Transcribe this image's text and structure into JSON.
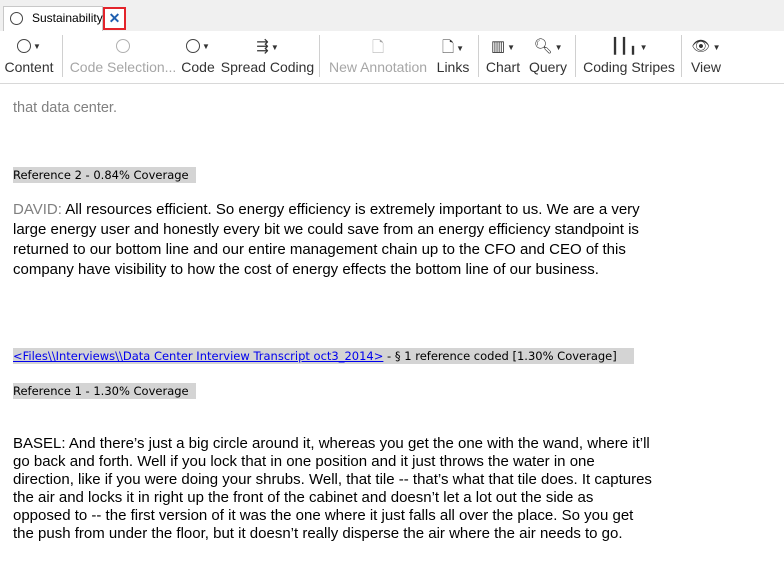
{
  "tab": {
    "label": "Sustainability",
    "close_glyph": "✕"
  },
  "ribbon": {
    "content": "Content",
    "code_selection": "Code Selection...",
    "code": "Code",
    "spread_coding": "Spread Coding",
    "new_annotation": "New Annotation",
    "links": "Links",
    "chart": "Chart",
    "query": "Query",
    "coding_stripes": "Coding Stripes",
    "view": "View"
  },
  "doc": {
    "top_fragment": "that data center.",
    "ref2_header": "Reference 2 - 0.84% Coverage",
    "david_speaker": "DAVID:",
    "david_text": "All resources efficient. So energy efficiency is extremely important to us. We are a very large energy user and honestly every bit we could save from an energy efficiency standpoint is returned to our bottom line and our entire management chain up to the CFO and CEO of this company have visibility to how the cost of energy effects the bottom line of our business.",
    "file_link": "<Files\\\\Interviews\\\\Data Center Interview Transcript oct3_2014>",
    "file_meta": " - § 1 reference coded  [1.30% Coverage]",
    "ref1_header": "Reference 1 - 1.30% Coverage",
    "basel_text": "BASEL:  And there’s just a big circle around it, whereas you get the one with the wand, where it’ll go back and forth. Well if you lock that in one position and it just throws the water in one direction, like if you were doing your shrubs. Well, that tile -- that’s what that tile does. It captures the air and locks it in right up the front of the cabinet and doesn’t let a lot out the side as opposed to -- the first version of it was the one where it just falls all over the place. So you get the push from under the floor, but it doesn’t really disperse the air where the air needs to go."
  }
}
